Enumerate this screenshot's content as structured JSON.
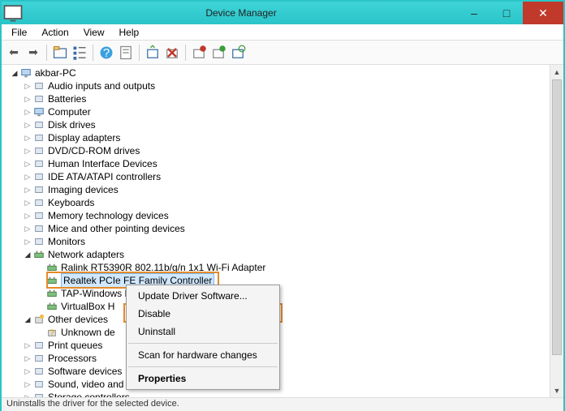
{
  "window": {
    "title": "Device Manager"
  },
  "menu": [
    "File",
    "Action",
    "View",
    "Help"
  ],
  "toolbar": {
    "icons": [
      "back-arrow-icon",
      "forward-arrow-icon",
      "sep",
      "up-level-icon",
      "tree-view-icon",
      "sep",
      "help-icon",
      "properties-icon",
      "sep",
      "refresh-icon",
      "uninstall-icon",
      "sep",
      "disable-icon",
      "enable-icon",
      "scan-icon"
    ]
  },
  "tree": {
    "root": "akbar-PC",
    "items": [
      {
        "label": "Audio inputs and outputs",
        "icon": "speaker"
      },
      {
        "label": "Batteries",
        "icon": "battery"
      },
      {
        "label": "Computer",
        "icon": "computer"
      },
      {
        "label": "Disk drives",
        "icon": "drive"
      },
      {
        "label": "Display adapters",
        "icon": "display"
      },
      {
        "label": "DVD/CD-ROM drives",
        "icon": "disc"
      },
      {
        "label": "Human Interface Devices",
        "icon": "hid"
      },
      {
        "label": "IDE ATA/ATAPI controllers",
        "icon": "ide"
      },
      {
        "label": "Imaging devices",
        "icon": "camera"
      },
      {
        "label": "Keyboards",
        "icon": "keyboard"
      },
      {
        "label": "Memory technology devices",
        "icon": "memory"
      },
      {
        "label": "Mice and other pointing devices",
        "icon": "mouse"
      },
      {
        "label": "Monitors",
        "icon": "monitor"
      },
      {
        "label": "Network adapters",
        "icon": "network",
        "expanded": true,
        "children": [
          {
            "label": "Ralink RT5390R 802.11b/g/n 1x1 Wi-Fi Adapter",
            "icon": "net"
          },
          {
            "label": "Realtek PCIe FE Family Controller",
            "icon": "net",
            "selected": true
          },
          {
            "label": "TAP-Windows H",
            "icon": "net",
            "truncated": true
          },
          {
            "label": "VirtualBox H",
            "icon": "net",
            "truncated": true
          }
        ]
      },
      {
        "label": "Other devices",
        "icon": "other",
        "expanded": true,
        "children": [
          {
            "label": "Unknown de",
            "icon": "unknown",
            "truncated": true
          }
        ]
      },
      {
        "label": "Print queues",
        "icon": "printer"
      },
      {
        "label": "Processors",
        "icon": "cpu"
      },
      {
        "label": "Software devices",
        "icon": "software"
      },
      {
        "label": "Sound, video and game controllers",
        "icon": "sound"
      },
      {
        "label": "Storage controllers",
        "icon": "storage",
        "truncated": true
      }
    ]
  },
  "context_menu": {
    "items": [
      {
        "label": "Update Driver Software..."
      },
      {
        "label": "Disable",
        "highlighted": true
      },
      {
        "label": "Uninstall"
      },
      {
        "sep": true
      },
      {
        "label": "Scan for hardware changes"
      },
      {
        "sep": true
      },
      {
        "label": "Properties",
        "bold": true
      }
    ]
  },
  "statusbar": "Uninstalls the driver for the selected device."
}
